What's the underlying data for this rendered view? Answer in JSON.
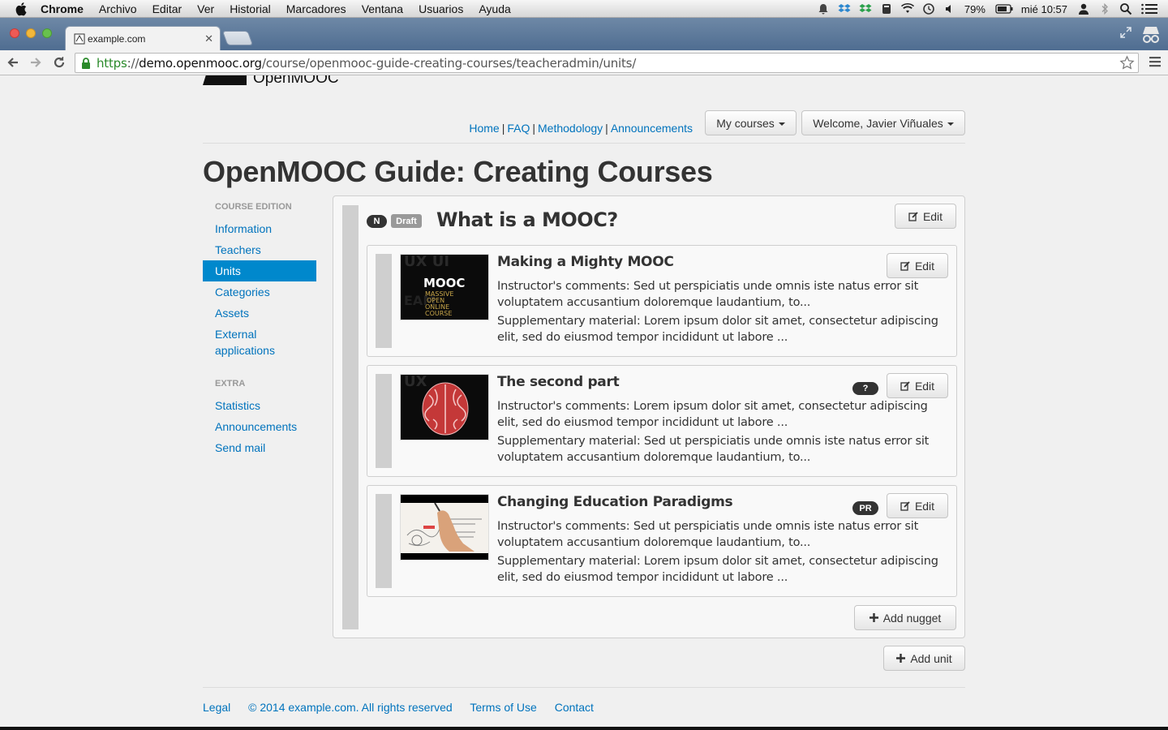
{
  "menubar": {
    "app": "Chrome",
    "items": [
      "Archivo",
      "Editar",
      "Ver",
      "Historial",
      "Marcadores",
      "Ventana",
      "Usuarios",
      "Ayuda"
    ],
    "battery": "79%",
    "clock": "mié 10:57"
  },
  "browser": {
    "tab_title": "example.com",
    "url_scheme": "https",
    "url_sep": "://",
    "url_domain": "demo.openmooc.org",
    "url_path": "/course/openmooc-guide-creating-courses/teacheradmin/units/"
  },
  "site": {
    "logo_text": "OpenMOOC",
    "nav": [
      "Home",
      "FAQ",
      "Methodology",
      "Announcements"
    ],
    "nav_sep": "|",
    "my_courses": "My courses",
    "welcome": "Welcome, Javier Viñuales"
  },
  "page_title": "OpenMOOC Guide: Creating Courses",
  "sidebar": {
    "section1": "COURSE EDITION",
    "items1": [
      "Information",
      "Teachers",
      "Units",
      "Categories",
      "Assets",
      "External applications"
    ],
    "active": "Units",
    "section2": "EXTRA",
    "items2": [
      "Statistics",
      "Announcements",
      "Send mail"
    ]
  },
  "unit": {
    "badge_n": "N",
    "badge_draft": "Draft",
    "title": "What is a MOOC?",
    "edit_label": "Edit",
    "add_nugget": "Add nugget"
  },
  "nuggets": [
    {
      "title": "Making a Mighty MOOC",
      "comment": "Instructor's comments: Sed ut perspiciatis unde omnis iste natus error sit voluptatem accusantium doloremque laudantium, to...",
      "supp": "Supplementary material: Lorem ipsum dolor sit amet, consectetur adipiscing elit, sed do eiusmod tempor incididunt ut labore ...",
      "badge": "",
      "thumb_text": [
        "MOOC",
        "MASSIVE",
        "OPEN",
        "ONLINE",
        "COURSE"
      ]
    },
    {
      "title": "The second part",
      "comment": "Instructor's comments: Lorem ipsum dolor sit amet, consectetur adipiscing elit, sed do eiusmod tempor incididunt ut labore ...",
      "supp": "Supplementary material: Sed ut perspiciatis unde omnis iste natus error sit voluptatem accusantium doloremque laudantium, to...",
      "badge": "?"
    },
    {
      "title": "Changing Education Paradigms",
      "comment": "Instructor's comments: Sed ut perspiciatis unde omnis iste natus error sit voluptatem accusantium doloremque laudantium, to...",
      "supp": "Supplementary material: Lorem ipsum dolor sit amet, consectetur adipiscing elit, sed do eiusmod tempor incididunt ut labore ...",
      "badge": "PR"
    }
  ],
  "add_unit": "Add unit",
  "footer": {
    "legal": "Legal",
    "copyright": "© 2014 example.com. All rights reserved",
    "terms": "Terms of Use",
    "contact": "Contact"
  },
  "colors": {
    "link": "#0073bd",
    "active_nav": "#0088cc",
    "badge_dark": "#333333",
    "badge_draft": "#999999"
  }
}
